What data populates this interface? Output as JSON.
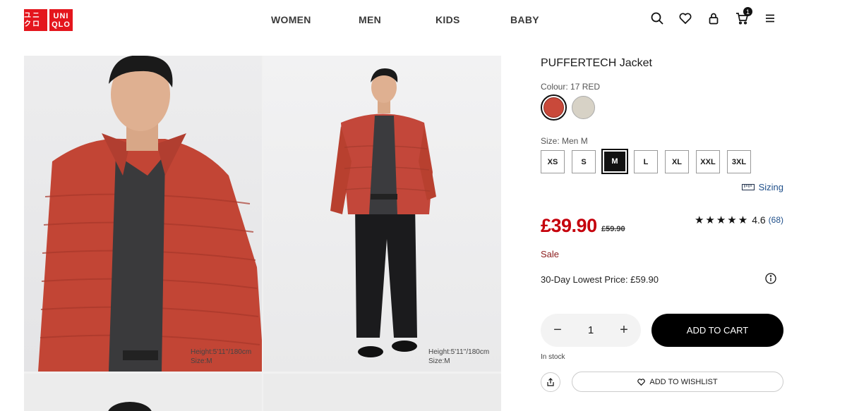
{
  "brand": {
    "line1": "ユニクロ",
    "line2a": "UNI",
    "line2b": "QLO"
  },
  "nav": [
    "WOMEN",
    "MEN",
    "KIDS",
    "BABY"
  ],
  "header_icons": [
    "search-icon",
    "heart-icon",
    "account-icon",
    "cart-icon",
    "menu-icon"
  ],
  "cart_count": "1",
  "gallery": {
    "caption1": [
      "Height:5'11''/180cm",
      "Size:M"
    ],
    "caption2": [
      "Height:5'11''/180cm",
      "Size:M"
    ]
  },
  "product": {
    "title": "PUFFERTECH Jacket",
    "colour_label": "Colour: 17 RED",
    "colours": [
      "#c9493a",
      "#d7d2c6"
    ],
    "size_label": "Size: Men M",
    "sizes": [
      "XS",
      "S",
      "M",
      "L",
      "XL",
      "XXL",
      "3XL"
    ],
    "selected_size": "M",
    "sizing_label": "Sizing",
    "price": "£39.90",
    "old_price": "£59.90",
    "rating": "4.6",
    "review_count": "(68)",
    "stars": "★★★★★",
    "sale_label": "Sale",
    "lowest_price": "30-Day Lowest Price: £59.90",
    "quantity": "1",
    "add_to_cart": "ADD TO CART",
    "stock": "In stock",
    "wishlist": "ADD TO WISHLIST"
  },
  "colors": {
    "accent_red": "#c5000c",
    "logo_red": "#e4161d",
    "link_blue": "#1f4f8a"
  }
}
